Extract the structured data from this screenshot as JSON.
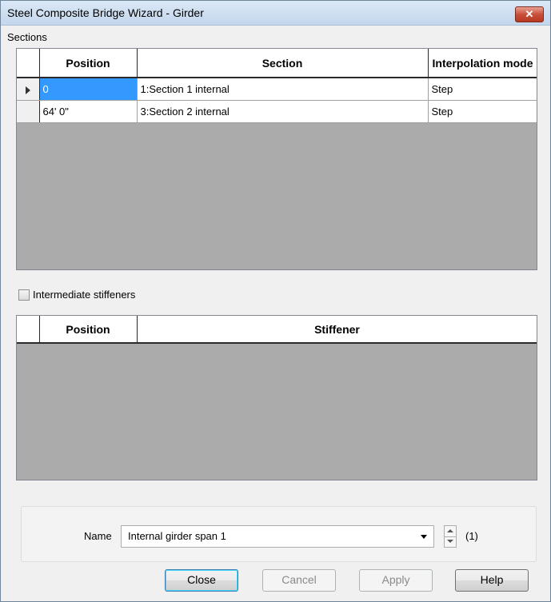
{
  "window": {
    "title": "Steel Composite Bridge Wizard - Girder",
    "close_glyph": "✕"
  },
  "sections": {
    "label": "Sections",
    "columns": [
      "Position",
      "Section",
      "Interpolation mode"
    ],
    "rows": [
      {
        "position": "0",
        "section": "1:Section 1 internal",
        "mode": "Step",
        "current": true
      },
      {
        "position": "64' 0\"",
        "section": "3:Section 2 internal",
        "mode": "Step",
        "current": false
      }
    ]
  },
  "stiffeners": {
    "checkbox_label": "Intermediate stiffeners",
    "checked": false,
    "columns": [
      "Position",
      "Stiffener"
    ],
    "rows": []
  },
  "name_field": {
    "label": "Name",
    "value": "Internal girder span 1",
    "counter": "(1)"
  },
  "buttons": {
    "close": "Close",
    "cancel": "Cancel",
    "apply": "Apply",
    "help": "Help"
  },
  "colors": {
    "selection": "#3399ff",
    "title_bar": "#c3d6ec",
    "close_button": "#c9503b"
  },
  "icons": [
    "close-icon",
    "row-pointer-icon",
    "dropdown-arrow-icon",
    "spin-up-icon",
    "spin-down-icon"
  ]
}
